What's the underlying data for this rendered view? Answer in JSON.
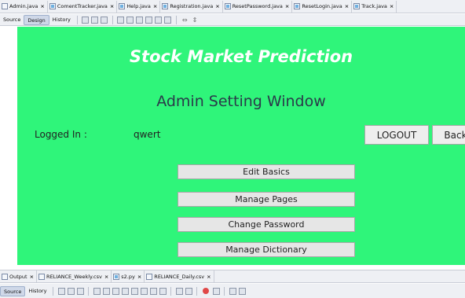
{
  "editor_tabs": [
    {
      "label": "Admin.java",
      "close": "×"
    },
    {
      "label": "ComentTracker.java",
      "close": "×"
    },
    {
      "label": "Help.java",
      "close": "×"
    },
    {
      "label": "Registration.java",
      "close": "×"
    },
    {
      "label": "ResetPassword.java",
      "close": "×"
    },
    {
      "label": "ResetLogin.java",
      "close": "×"
    },
    {
      "label": "Track.java",
      "close": "×"
    }
  ],
  "toolbar": {
    "source": "Source",
    "design": "Design",
    "history": "History"
  },
  "form": {
    "app_title": "Stock Market Prediction",
    "window_title": "Admin Setting Window",
    "logged_in_label": "Logged In :",
    "logged_in_user": "qwert",
    "logout_label": "LOGOUT",
    "back_label": "Back",
    "menu": {
      "edit_basics": "Edit Basics",
      "manage_pages": "Manage Pages",
      "change_password": "Change Password",
      "manage_dictionary": "Manage Dictionary"
    },
    "background_color": "#2ff57a"
  },
  "output_tabs": [
    {
      "label": "Output",
      "close": "×"
    },
    {
      "label": "RELIANCE_Weekly.csv",
      "close": "×"
    },
    {
      "label": "s2.py",
      "close": "×"
    },
    {
      "label": "RELIANCE_Daily.csv",
      "close": "×"
    }
  ],
  "output_toolbar": {
    "source": "Source",
    "history": "History"
  }
}
